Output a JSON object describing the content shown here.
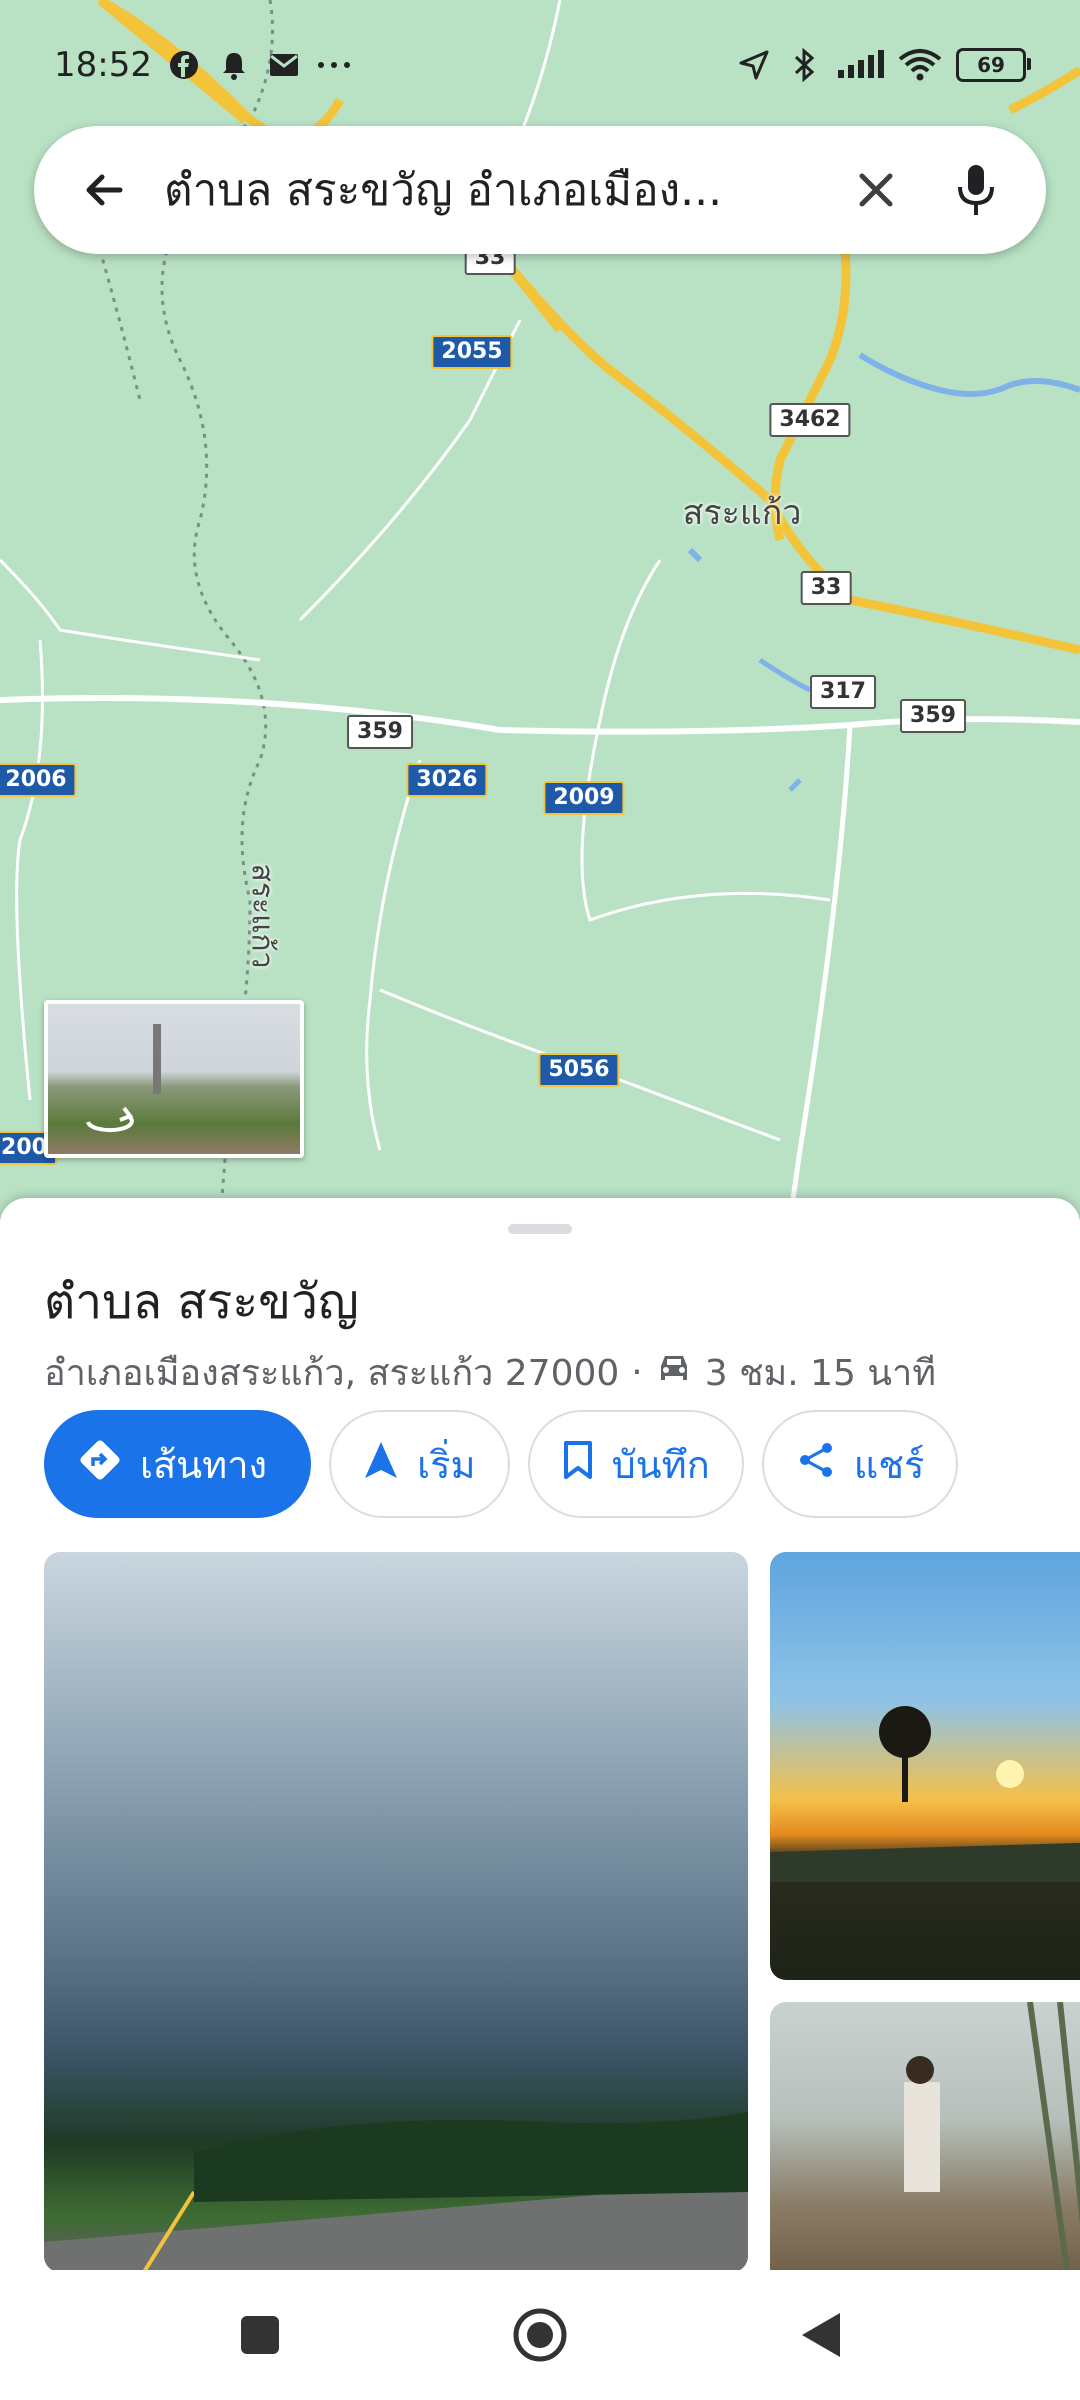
{
  "status_bar": {
    "time": "18:52",
    "left_icons": [
      "facebook-icon",
      "bell-icon",
      "mail-icon",
      "more-dots-icon"
    ],
    "right_icons": [
      "location-arrow-icon",
      "bluetooth-icon",
      "signal-icon",
      "wifi-icon",
      "battery-icon"
    ],
    "battery": "69"
  },
  "search": {
    "query": "ตำบล สระขวัญ อำเภอเมือง..."
  },
  "map": {
    "town_labels": [
      "สระแก้ว",
      "สระแก้ว"
    ],
    "route_shields": {
      "r2055": "2055",
      "r3462": "3462",
      "r33a": "33",
      "r33b": "33",
      "r317": "317",
      "r359a": "359",
      "r359b": "359",
      "r2006": "2006",
      "r3026": "3026",
      "r2009": "2009",
      "r5056": "5056",
      "r200x": "200"
    },
    "colors": {
      "land": "#b9e2c4",
      "highway": "#f3c43a",
      "road": "#ffffff",
      "water": "#7fb2e8"
    }
  },
  "place": {
    "title": "ตำบล สระขวัญ",
    "address": "อำเภอเมืองสระแก้ว, สระแก้ว 27000",
    "separator": "·",
    "drive_time": "3 ชม. 15 นาที"
  },
  "actions": {
    "directions": "เส้นทาง",
    "start": "เริ่ม",
    "save": "บันทึก",
    "share": "แชร์"
  },
  "colors": {
    "accent": "#1a73e8"
  }
}
